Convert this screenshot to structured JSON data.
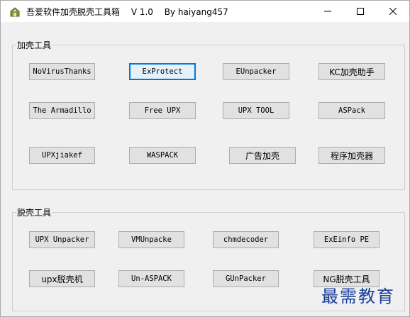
{
  "window": {
    "title": "吾爱软件加壳脱壳工具箱　 V 1.0　 By haiyang457",
    "minimize_glyph": "—",
    "maximize_glyph": "☐",
    "close_glyph": "✕",
    "app_icon": "app-icon"
  },
  "pack_group": {
    "label": "加壳工具",
    "buttons": [
      "NoVirusThanks",
      "ExProtect",
      "EUnpacker",
      "KC加壳助手",
      "The Armadillo",
      "Free UPX",
      "UPX TOOL",
      "ASPack",
      "UPXjiakef",
      "WASPACK",
      "广告加壳",
      "程序加壳器"
    ],
    "focused_index": 1
  },
  "unpack_group": {
    "label": "脱壳工具",
    "buttons": [
      "UPX Unpacker",
      "VMUnpacke",
      "chmdecoder",
      "ExEinfo PE",
      "upx脱壳机",
      "Un-ASPACK",
      "GUnPacker",
      "NG脱壳工具"
    ]
  },
  "watermark": "最需教育",
  "colors": {
    "accent": "#0078d7",
    "watermark": "#1a3f9c"
  }
}
